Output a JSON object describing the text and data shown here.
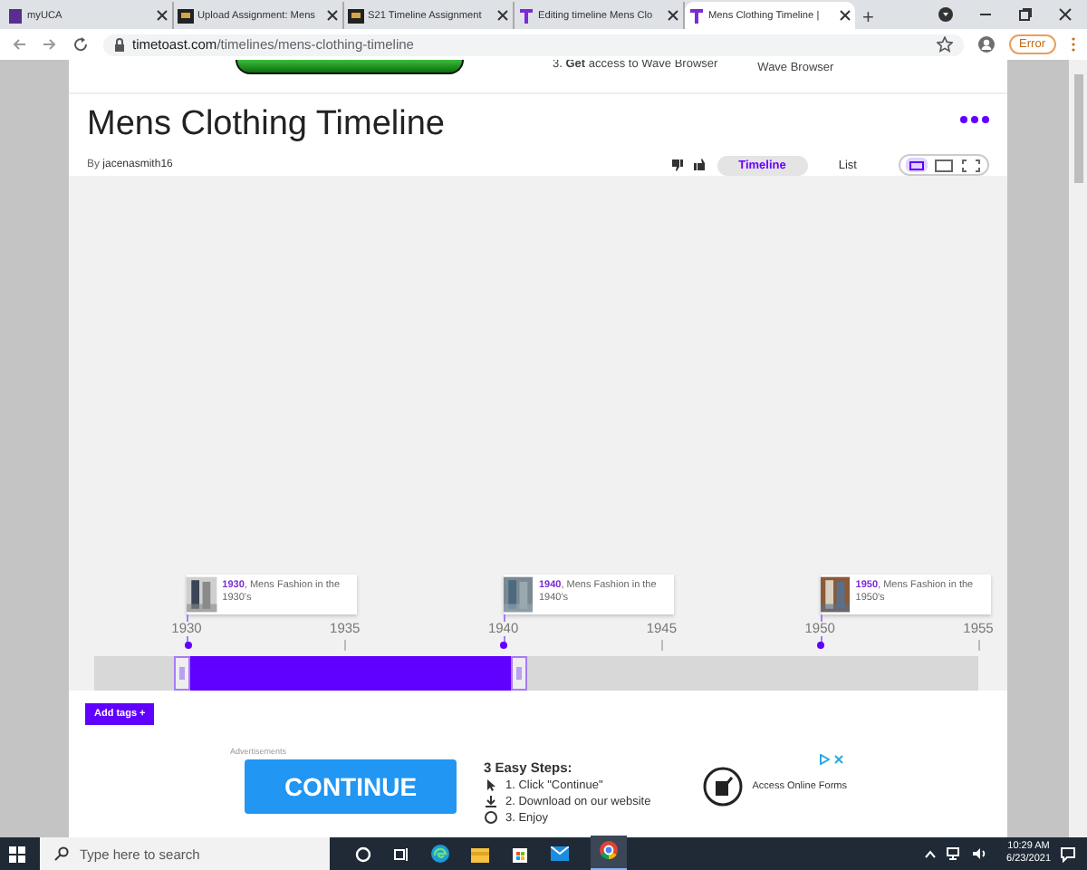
{
  "browser": {
    "tabs": [
      {
        "title": "myUCA",
        "kind": "book",
        "selected": false
      },
      {
        "title": "Upload Assignment: Mens",
        "kind": "bb",
        "selected": false
      },
      {
        "title": "S21 Timeline Assignment",
        "kind": "bb",
        "selected": false
      },
      {
        "title": "Editing timeline Mens Clo",
        "kind": "t",
        "selected": false
      },
      {
        "title": "Mens Clothing Timeline |",
        "kind": "t",
        "selected": true
      }
    ],
    "new_tab": "+",
    "url_host": "timetoast.com",
    "url_path": "/timelines/mens-clothing-timeline",
    "profile_button": "Error"
  },
  "top_ad": {
    "step": "3. **Get** access to Wave Browser",
    "caption": "Wave Browser"
  },
  "header": {
    "title": "Mens Clothing Timeline",
    "by": "By",
    "author": "jacenasmith16",
    "views": [
      {
        "label": "Timeline",
        "selected": true
      },
      {
        "label": "List",
        "selected": false
      }
    ],
    "layouts": [
      {
        "kind": "narrow",
        "selected": true
      },
      {
        "kind": "wide",
        "selected": false
      },
      {
        "kind": "fullscreen",
        "selected": false
      }
    ]
  },
  "timeline": {
    "ticks": [
      "1930",
      "1935",
      "1940",
      "1945",
      "1950",
      "1955"
    ],
    "events": [
      {
        "year": "1930",
        "text": ", Mens Fashion in the 1930's"
      },
      {
        "year": "1940",
        "text": ", Mens Fashion in the 1940's"
      },
      {
        "year": "1950",
        "text": ", Mens Fashion in the 1950's"
      }
    ],
    "range": {
      "level": 0.41
    }
  },
  "add_tags": "Add tags +",
  "ad": {
    "label": "Advertisements",
    "button": "CONTINUE",
    "heading": "3 Easy Steps:",
    "steps": [
      "1. Click \"Continue\"",
      "2. Download on our website",
      "3. Enjoy"
    ],
    "side_text": "Access Online Forms"
  },
  "taskbar": {
    "search_placeholder": "Type here to search",
    "time": "10:29 AM",
    "date": "6/23/2021"
  }
}
